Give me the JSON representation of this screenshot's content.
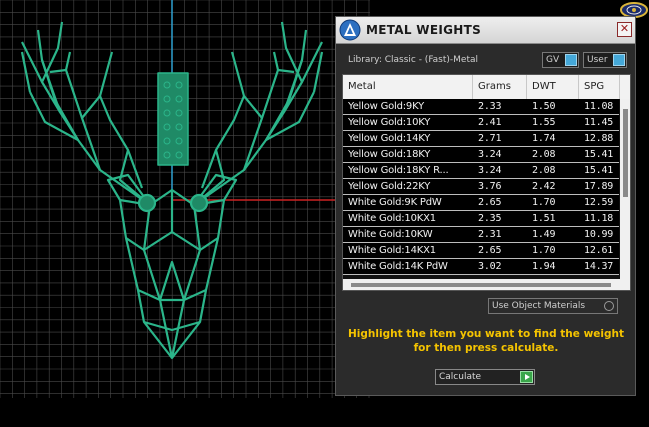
{
  "dialog": {
    "title": "METAL WEIGHTS",
    "close_glyph": "✕",
    "library_label": "Library: Classic - (Fast)-Metal",
    "toggles": {
      "gv": "GV",
      "user": "User"
    }
  },
  "table": {
    "columns": [
      "Metal",
      "Grams",
      "DWT",
      "SPG"
    ],
    "rows": [
      [
        "Yellow Gold:9KY",
        "2.33",
        "1.50",
        "11.08"
      ],
      [
        "Yellow Gold:10KY",
        "2.41",
        "1.55",
        "11.45"
      ],
      [
        "Yellow Gold:14KY",
        "2.71",
        "1.74",
        "12.88"
      ],
      [
        "Yellow Gold:18KY",
        "3.24",
        "2.08",
        "15.41"
      ],
      [
        "Yellow Gold:18KY R...",
        "3.24",
        "2.08",
        "15.41"
      ],
      [
        "Yellow Gold:22KY",
        "3.76",
        "2.42",
        "17.89"
      ],
      [
        "White Gold:9K PdW",
        "2.65",
        "1.70",
        "12.59"
      ],
      [
        "White Gold:10KX1",
        "2.35",
        "1.51",
        "11.18"
      ],
      [
        "White Gold:10KW",
        "2.31",
        "1.49",
        "10.99"
      ],
      [
        "White Gold:14KX1",
        "2.65",
        "1.70",
        "12.61"
      ],
      [
        "White Gold:14K PdW",
        "3.02",
        "1.94",
        "14.37"
      ]
    ]
  },
  "options": {
    "use_object_materials": "Use Object Materials"
  },
  "instructions": "Highlight the item you want to find the weight for then press calculate.",
  "calculate_button": "Calculate",
  "icons": {
    "app_logo": "app-logo-icon",
    "close": "close-icon",
    "toggle_indicator": "toggle-indicator-icon",
    "radio": "radio-icon",
    "play_arrow": "play-arrow-icon",
    "gizmo": "view-gizmo-icon"
  },
  "colors": {
    "model": "#2bb58a",
    "grid": "#4a4a4a",
    "axis_y": "#2e9fd0",
    "axis_x": "#cc2222",
    "instructions": "#f5c400",
    "toggle_on": "#45a8d8",
    "play": "#3aa64a"
  }
}
